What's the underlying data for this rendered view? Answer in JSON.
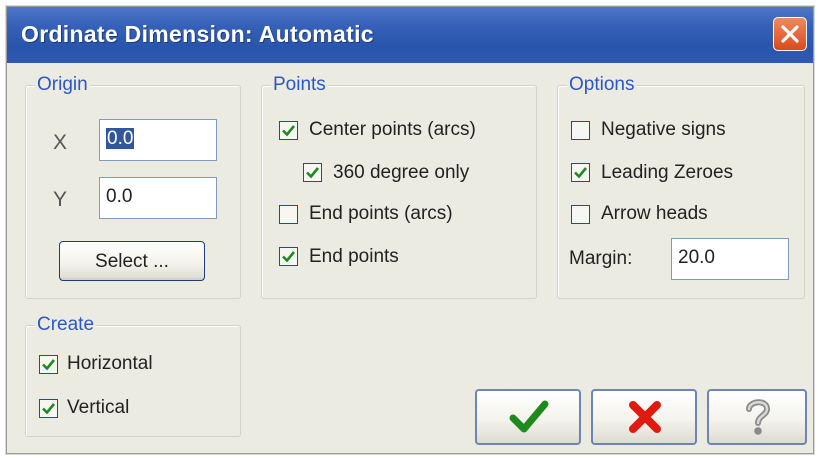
{
  "window": {
    "title": "Ordinate Dimension: Automatic"
  },
  "origin": {
    "legend": "Origin",
    "x_label": "X",
    "x_value": "0.0",
    "y_label": "Y",
    "y_value": "0.0",
    "select_label": "Select ..."
  },
  "points": {
    "legend": "Points",
    "items": [
      {
        "label": "Center points (arcs)",
        "checked": true
      },
      {
        "label": "360 degree only",
        "checked": true
      },
      {
        "label": "End points (arcs)",
        "checked": false
      },
      {
        "label": "End points",
        "checked": true
      }
    ]
  },
  "options": {
    "legend": "Options",
    "items": [
      {
        "label": "Negative signs",
        "checked": false
      },
      {
        "label": "Leading Zeroes",
        "checked": true
      },
      {
        "label": "Arrow heads",
        "checked": false
      }
    ],
    "margin_label": "Margin:",
    "margin_value": "20.0"
  },
  "create": {
    "legend": "Create",
    "items": [
      {
        "label": "Horizontal",
        "checked": true
      },
      {
        "label": "Vertical",
        "checked": true
      }
    ]
  },
  "buttons": {
    "ok_icon": "checkmark-icon",
    "cancel_icon": "red-x-icon",
    "help_icon": "question-mark-icon"
  },
  "colors": {
    "titlebar": "#2f59b2",
    "legend_text": "#2b57c7",
    "check": "#1e8a1e",
    "cancel": "#e01a10"
  }
}
